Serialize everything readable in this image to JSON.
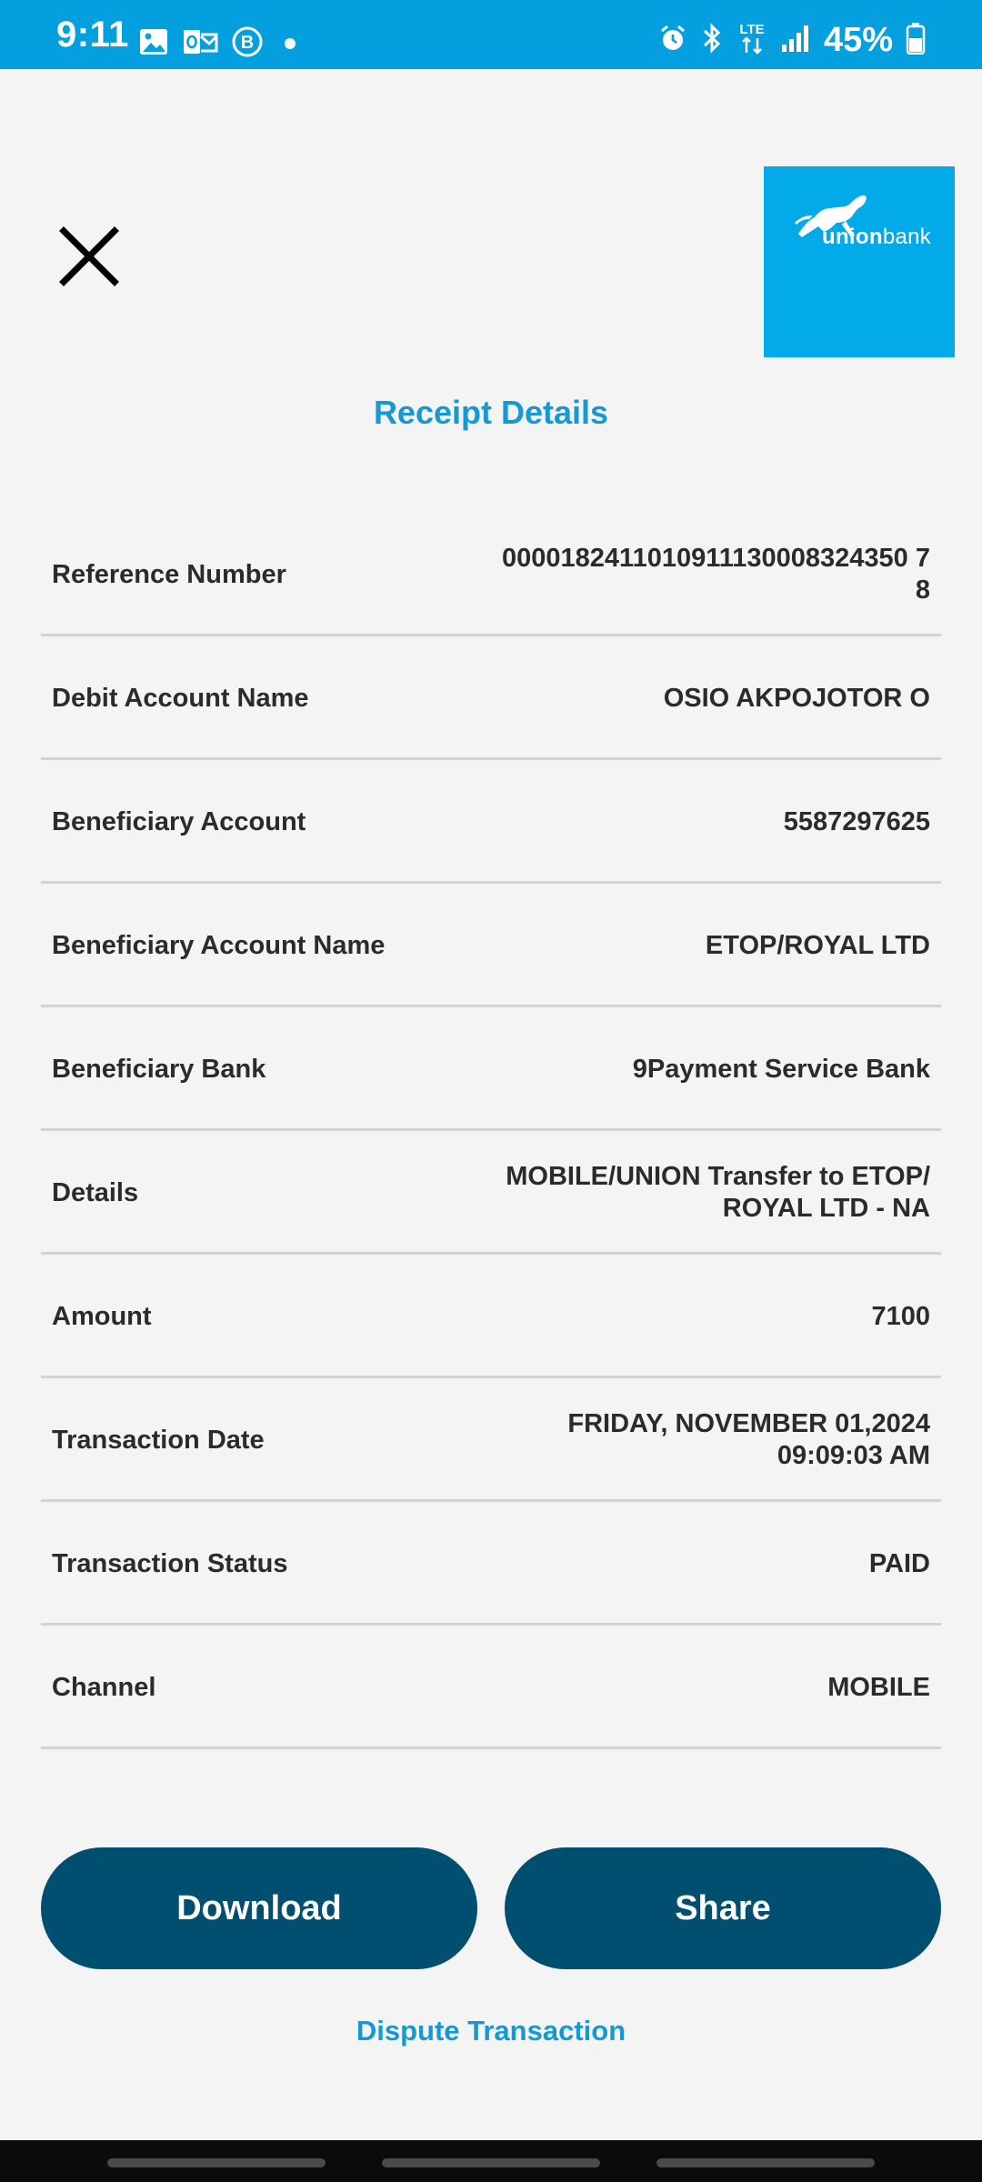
{
  "status_bar": {
    "time": "9:11",
    "battery": "45%",
    "left_icons": [
      "gallery-icon",
      "outlook-icon",
      "b-circle-icon",
      "dot-icon"
    ],
    "right_icons": [
      "alarm-icon",
      "bluetooth-icon",
      "lte-icon",
      "signal-icon",
      "battery-icon"
    ],
    "background_color": "#039fdf"
  },
  "header": {
    "close_icon": "close-icon",
    "logo": {
      "brand_bold": "union",
      "brand_regular": "bank",
      "background_color": "#03aae9"
    }
  },
  "title": "Receipt Details",
  "details": [
    {
      "label": "Reference Number",
      "value": "0000182411010911130008324350 78"
    },
    {
      "label": "Debit Account Name",
      "value": "OSIO AKPOJOTOR O"
    },
    {
      "label": "Beneficiary Account",
      "value": "5587297625"
    },
    {
      "label": "Beneficiary Account Name",
      "value": "ETOP/ROYAL LTD"
    },
    {
      "label": "Beneficiary Bank",
      "value": "9Payment Service Bank"
    },
    {
      "label": "Details",
      "value": "MOBILE/UNION Transfer to ETOP/ ROYAL LTD - NA"
    },
    {
      "label": "Amount",
      "value": "7100"
    },
    {
      "label": "Transaction Date",
      "value": "FRIDAY, NOVEMBER 01,2024 09:09:03 AM"
    },
    {
      "label": "Transaction Status",
      "value": "PAID"
    },
    {
      "label": "Channel",
      "value": "MOBILE"
    }
  ],
  "actions": {
    "download_label": "Download",
    "share_label": "Share",
    "dispute_label": "Dispute Transaction",
    "button_color": "#004f71",
    "link_color": "#1598d3"
  }
}
